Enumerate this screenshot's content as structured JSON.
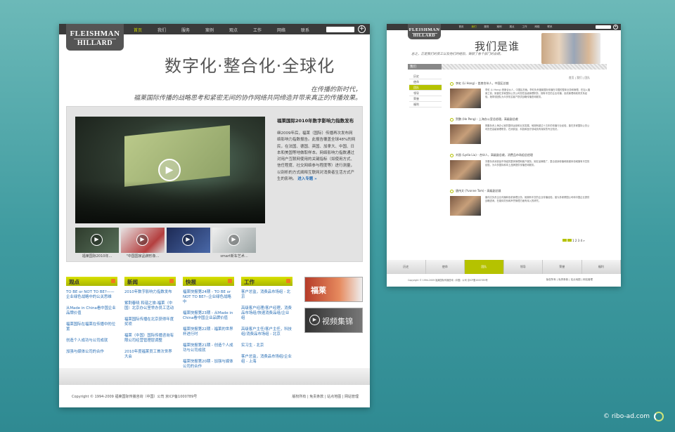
{
  "logo": {
    "line1": "FLEISHMAN",
    "line2": "HILLARD"
  },
  "nav": [
    "首页",
    "我们",
    "服务",
    "案例",
    "观点",
    "工作",
    "网络",
    "联系"
  ],
  "search_button": "+",
  "hero": {
    "slogan": "数字化·整合化·全球化",
    "sub1": "在传播的新时代，",
    "sub2": "福莱国际传播的战略思考和紧密无间的协作网络共同缔造并带来真正的传播效果。"
  },
  "feature": {
    "title": "福莱国际2010年数字影响力指数发布",
    "body": "继2009年后，福莱（国际）传播再次发布网络影响力指数报告。此报告覆盖全球48%的网民，在法国、德国、英国、加拿大、中国、日本和美国等地做取样本。网络影响力指数通过对用户互联网使用的关键指标（如使用方式、信任程度、社交网络参与程度等）进行测量，以剖析的方式阐释互联网对消费者生活方式产生的影响。",
    "more": "进入专题 »"
  },
  "thumbs": [
    "福莱国际2010年...",
    "\"中国国家品牌形象...",
    "",
    "smart新车艺术..."
  ],
  "columns": [
    {
      "title": "观点",
      "items": [
        "TO BE or NOT TO BE?——企业绿色战略中的公关思维",
        "从Made in China看中国企业品牌价值",
        "福莱国际在福莱在传播中的位置",
        "创造个人成功与公司成就",
        "加强与媒体公司的合作"
      ]
    },
    {
      "title": "新闻",
      "items": [
        "2010年数字影响力指数发布",
        "紫荆春晓 和谐之旅-福莱（中国）北京办公室举办员工活动",
        "福莱国际传播在北京获得年度奖项",
        "福莱（中国）国际传播咨询有限公司经营管理层调整",
        "2010年度福莱员工首次世界大会"
      ]
    },
    {
      "title": "快报",
      "items": [
        "福莱快报第24期 - TO BE or NOT TO BE?--企业绿色战略中",
        "福莱快报第23期 - 从Made in China看中国企业品牌价值",
        "福莱快报第22期 - 福莱的世界杯进行时",
        "福莱快报第21期 - 创造个人成功与公司成就",
        "福莱快报第20期 - 加强与媒体公司的合作"
      ]
    },
    {
      "title": "工作",
      "items": [
        "客户总监，消费品市场组 - 北京",
        "高级客户经理/客户经理，消费品市场组/快速消费品组/企业组",
        "高级客户主任/客户主任，科技组/消费品市场组 - 北京",
        "实习生 - 北京",
        "客户总监，消费品市场组/企业组 - 上海"
      ]
    }
  ],
  "banners": {
    "b1": "福莱",
    "b2": "视频集锦"
  },
  "footer": {
    "copyright": "Copyright © 1994-2009 福莱国际传播咨询（中国）公司 京ICP备1000789号",
    "links": "版权所有  |  免责条款  |  站点地图  |  网站管理"
  },
  "right": {
    "title": "我们是谁",
    "subtitle": "总之，正是我们的员工以及他们的经验，铸就了各个部门的业绩。",
    "tab": "我们",
    "side": [
      "历史",
      "使命",
      "团队",
      "领导",
      "荣誉",
      "福利"
    ],
    "crumbs": "首页  |  我们  |  团队",
    "persons": [
      {
        "name": "李虹 (Li Hong) - 首席合伙人，中国区总裁",
        "text": "李虹 (Li Hong) 首席合伙人，中国区总裁。李虹负责福莱国际传播在中国的整体业务和管理。在加入福莱之前，她曾在多家国际公关公司担任高级管理职务，拥有丰富的企业传播、危机管理和政府关系经验。她带领团队为众多知名客户提供战略传播咨询服务。"
      },
      {
        "name": "贺鹏 (He Peng) - 上海办公室总经理，高级副总裁",
        "text": "贺鹏负责上海办公室的整体运营和业务发展。他拥有超过十五年的传播行业经验，曾在多家国际公关公司担任高级管理职务，在消费品、科技和医疗领域具有深厚的专业知识。"
      },
      {
        "name": "刘晋 (Lydia Liu) - 合伙人，高级副总裁，消费品市场组总经理",
        "text": "刘晋负责消费品市场组的整体管理和客户服务。她在品牌推广、整合营销传播和新媒体领域拥有丰富的经验，为众多国际和本土品牌提供传播咨询服务。"
      },
      {
        "name": "唐伟文 (Yvonne Tom) - 高级副总裁",
        "text": "唐伟文负责企业传播和危机管理业务。她拥有丰富的企业传播经验，曾为多家跨国公司和中国企业提供战略咨询，在媒体关系和声誉管理方面有深入的研究。"
      }
    ],
    "pager": "1 2 3 4 »",
    "tabs": [
      "历史",
      "使命",
      "团队",
      "领导",
      "荣誉",
      "福利"
    ],
    "copyright": "Copyright © 1994-2009 福莱国际传播咨询（中国）公司 京ICP备1000789号",
    "links": "版权所有  |  免责条款  |  站点地图  |  网站管理"
  },
  "watermark": "© ribo-ad.com",
  "colors": {
    "accent": "#b5c200",
    "topbar": "#3a3a3a",
    "link": "#2a6fb5",
    "background": "#3f9ba0"
  }
}
